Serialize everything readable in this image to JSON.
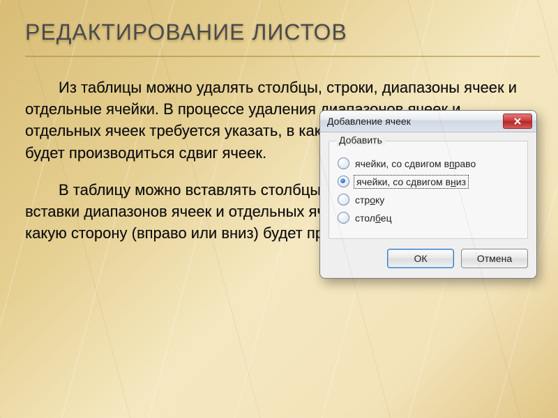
{
  "title": "РЕДАКТИРОВАНИЕ ЛИСТОВ",
  "para1": "Из таблицы можно удалять столбцы, строки, диапазоны ячеек и отдельные ячейки. В процессе удаления диапазонов ячеек и отдельных ячеек требуется указать, в какую сторону (влево или вверх) будет производиться сдвиг ячеек.",
  "para2": "В таблицу можно вставлять столбцы, строки и ячейки. В процессе вставки диапазонов ячеек и отдельных ячеек требуется указать, в какую сторону (вправо или вниз) будет производиться сдвиг ячеек.",
  "dialog": {
    "title": "Добавление ячеек",
    "group_label": "Добавить",
    "options": {
      "shift_right": "ячейки, со сдвигом вправо",
      "shift_down": "ячейки, со сдвигом вниз",
      "row": "строку",
      "column": "столбец"
    },
    "hotkeys": {
      "shift_right": "п",
      "shift_down": "н",
      "row": "о",
      "column": "б"
    },
    "selected": "shift_down",
    "ok": "ОК",
    "cancel": "Отмена"
  }
}
